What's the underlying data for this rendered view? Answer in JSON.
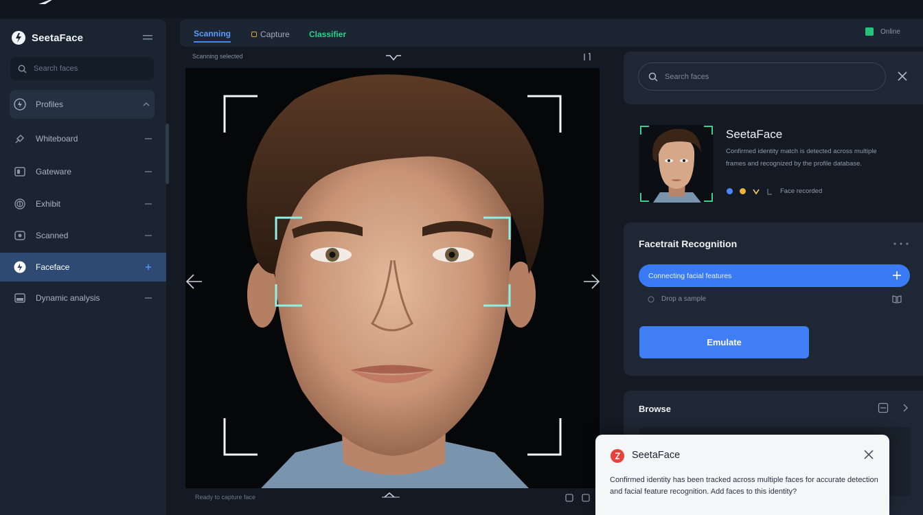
{
  "app": {
    "name": "SeetaFace"
  },
  "colors": {
    "accent": "#3f7ef4",
    "active_nav": "#2e4a72",
    "success": "#27c27b",
    "corner_bracket": "#8ef0e6",
    "toast_icon": "#e8413a"
  },
  "sidebar": {
    "search_placeholder": "Search faces",
    "items": [
      {
        "label": "Profiles",
        "icon": "face-scan-icon",
        "tail": "caret-icon"
      },
      {
        "label": "Whiteboard",
        "icon": "brush-icon",
        "tail": "minus-icon"
      },
      {
        "label": "Gateware",
        "icon": "gallery-icon",
        "tail": "minus-icon"
      },
      {
        "label": "Exhibit",
        "icon": "fingerprint-icon",
        "tail": "minus-icon"
      },
      {
        "label": "Scanned",
        "icon": "camera-icon",
        "tail": "minus-icon"
      },
      {
        "label": "Faceface",
        "icon": "face-scan-icon",
        "tail": "plus-icon"
      },
      {
        "label": "Dynamic analysis",
        "icon": "database-icon",
        "tail": "minus-icon"
      }
    ]
  },
  "tabs": [
    {
      "label": "Scanning",
      "state": "active"
    },
    {
      "label": "Capture",
      "state": "normal"
    },
    {
      "label": "Classifier",
      "state": "highlight"
    }
  ],
  "header_right": {
    "label": "Online"
  },
  "camera": {
    "label": "Scanning selected",
    "bottom_label": "Ready to capture face"
  },
  "right_search": {
    "placeholder": "Search faces"
  },
  "profile": {
    "name": "SeetaFace",
    "description": "Confirmed identity match is detected across multiple frames and recognized by the profile database.",
    "meta_text": "Face recorded",
    "meta_dots": [
      "#4a86ff",
      "#f0b23a",
      "#f0c95a"
    ]
  },
  "recognition": {
    "title": "Facetrait Recognition",
    "option_label": "Connecting facial features",
    "sub_label": "Drop a sample",
    "button_label": "Emulate"
  },
  "lower_card": {
    "title": "Browse"
  },
  "toast": {
    "title": "SeetaFace",
    "body": "Confirmed identity has been tracked across multiple faces for accurate detection and facial feature recognition. Add faces to this identity?"
  }
}
